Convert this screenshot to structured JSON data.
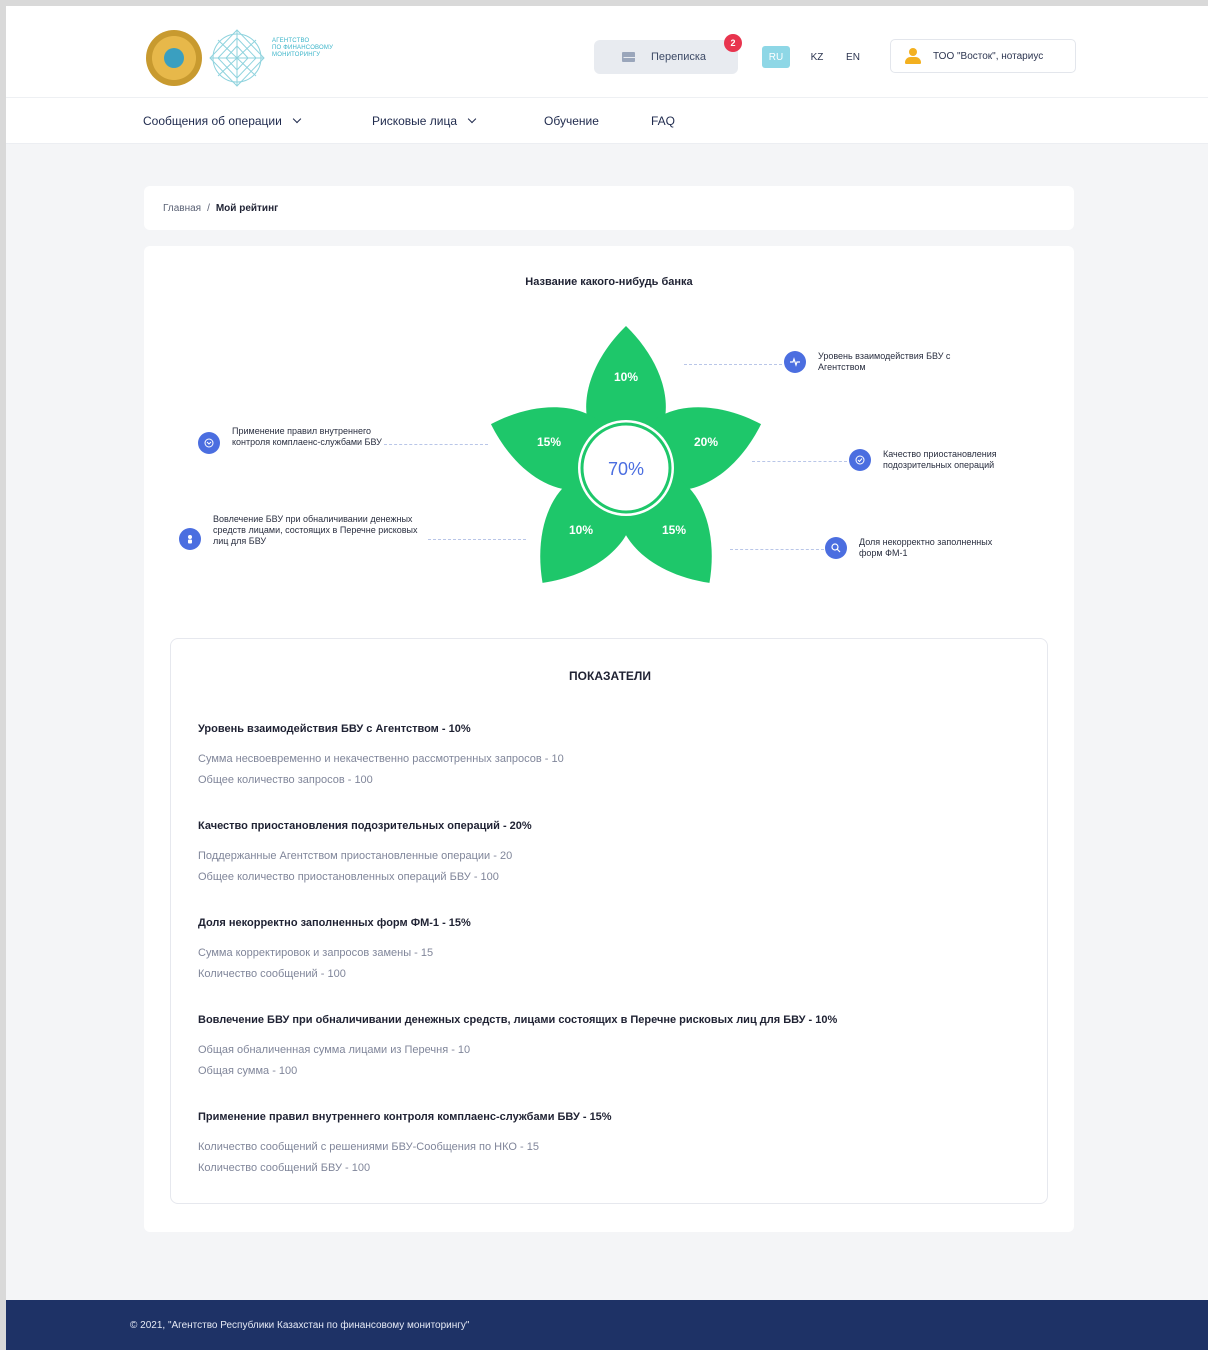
{
  "header": {
    "logo_lines": [
      "АГЕНТСТВО",
      "ПО ФИНАНСОВОМУ",
      "МОНИТОРИНГУ"
    ],
    "messages_label": "Переписка",
    "messages_count": "2",
    "languages": [
      "RU",
      "KZ",
      "EN"
    ],
    "active_language": "RU",
    "user_name": "ТОО \"Восток\", нотариус"
  },
  "nav": {
    "items": [
      {
        "label": "Сообщения об операции",
        "dropdown": true
      },
      {
        "label": "Рисковые лица",
        "dropdown": true
      },
      {
        "label": "Обучение",
        "dropdown": false
      },
      {
        "label": "FAQ",
        "dropdown": false
      }
    ]
  },
  "breadcrumb": {
    "home": "Главная",
    "separator": "/",
    "current": "Мой рейтинг"
  },
  "rating": {
    "title": "Название какого-нибудь банка",
    "total": "70%",
    "petals": [
      "10%",
      "20%",
      "15%",
      "10%",
      "15%"
    ],
    "legend": [
      {
        "text": "Уровень взаимодействия БВУ с Агентством",
        "icon": "pulse-icon"
      },
      {
        "text": "Качество приостановления подозрительных операций",
        "icon": "check-icon"
      },
      {
        "text": "Доля некорректно заполненных форм ФМ-1",
        "icon": "search-icon"
      },
      {
        "text": "Вовлечение БВУ при обналичивании денежных средств лицами, состоящих в Перечне рисковых лиц для БВУ",
        "icon": "person-icon"
      },
      {
        "text": "Применение правил внутреннего контроля комплаенс-службами БВУ",
        "icon": "mail-icon"
      }
    ],
    "colors": {
      "petal": "#1ec76a",
      "accent": "#4b6ee0"
    }
  },
  "indicators": {
    "title": "ПОКАЗАТЕЛИ",
    "groups": [
      {
        "heading": "Уровень взаимодействия БВУ с Агентством - 10%",
        "items": [
          "Сумма несвоевременно и некачественно рассмотренных запросов - 10",
          "Общее количество запросов - 100"
        ]
      },
      {
        "heading": "Качество приостановления подозрительных операций - 20%",
        "items": [
          "Поддержанные Агентством приостановленные операции - 20",
          "Общее количество приостановленных операций БВУ - 100"
        ]
      },
      {
        "heading": "Доля некорректно заполненных форм ФМ-1 - 15%",
        "items": [
          "Сумма корректировок и запросов замены - 15",
          "Количество сообщений - 100"
        ]
      },
      {
        "heading": "Вовлечение БВУ при обналичивании денежных средств, лицами состоящих в Перечне рисковых лиц для БВУ - 10%",
        "items": [
          "Общая обналиченная сумма лицами из Перечня - 10",
          "Общая сумма - 100"
        ]
      },
      {
        "heading": "Применение правил внутреннего контроля комплаенс-службами БВУ - 15%",
        "items": [
          "Количество сообщений с решениями БВУ-Сообщения по НКО - 15",
          "Количество сообщений БВУ - 100"
        ]
      }
    ]
  },
  "footer": {
    "text": "© 2021, \"Агентство Республики Казахстан по финансовому мониторингу\""
  }
}
